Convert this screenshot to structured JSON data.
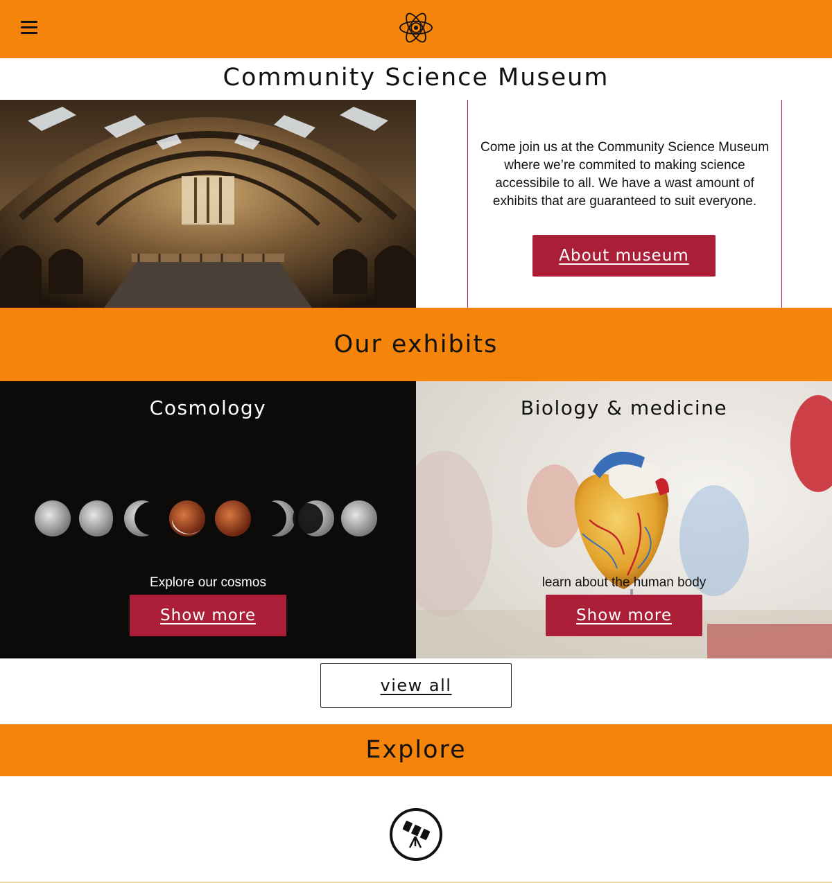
{
  "header": {
    "menu_icon": "hamburger-icon",
    "logo_icon": "atom-icon"
  },
  "site_title": "Community Science Museum",
  "hero": {
    "image": "museum-hall-image",
    "text": "Come join us at the Community Science Museum where we’re commited to making science accessibile to all. We have a wast amount of exhibits that are guaranteed to suit everyone.",
    "button_label": "About museum"
  },
  "exhibits": {
    "heading": "Our exhibits",
    "cards": [
      {
        "title": "Cosmology",
        "description": "Explore our cosmos",
        "button_label": "Show more",
        "image": "moon-phases-image"
      },
      {
        "title": "Biology & medicine",
        "description": "learn about the human body",
        "button_label": "Show more",
        "image": "heart-model-image"
      }
    ],
    "view_all_label": "view all"
  },
  "explore": {
    "heading": "Explore",
    "icon": "telescope-icon"
  },
  "colors": {
    "orange": "#f5840b",
    "crimson": "#ab1e38"
  }
}
